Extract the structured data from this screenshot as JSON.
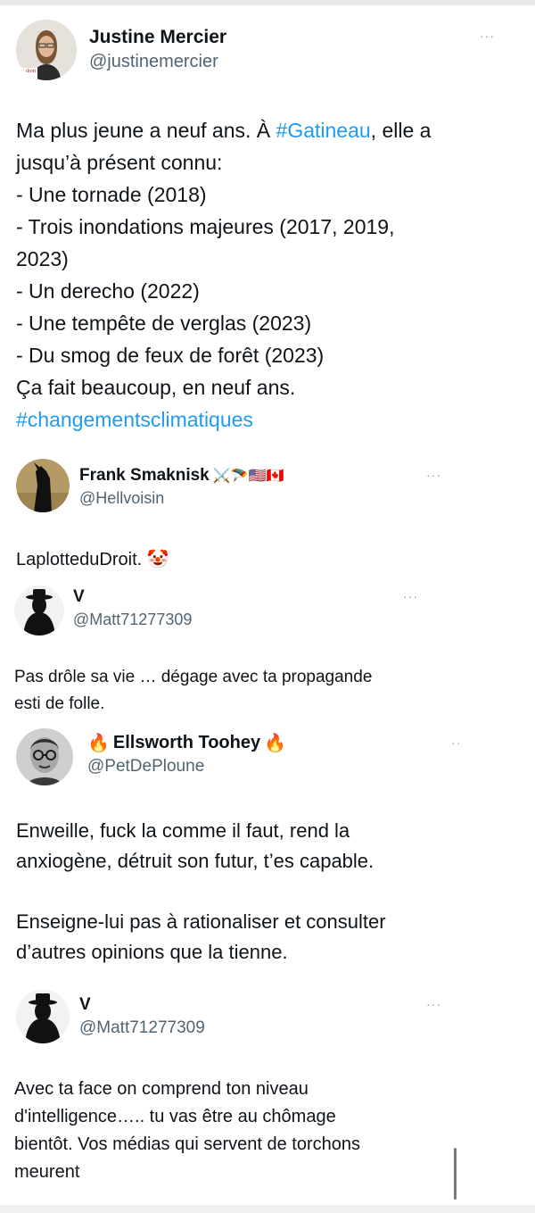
{
  "tweets": [
    {
      "name": "Justine Mercier",
      "handle": "@justinemercier",
      "avatar_badge": "le droit",
      "more": "···",
      "body_before": "Ma plus jeune a neuf ans. À ",
      "hashtag1": "#Gatineau",
      "body_middle": ", elle a\njusqu’à présent connu:\n- Une tornade (2018)\n- Trois inondations majeures (2017, 2019,\n2023)\n- Un derecho (2022)\n- Une tempête de verglas (2023)\n- Du smog de feux de forêt (2023)\nÇa fait beaucoup, en neuf ans.\n",
      "hashtag2": "#changementsclimatiques"
    },
    {
      "name": "Frank Smaknisk",
      "name_emoji": "⚔️🪂🇺🇸🇨🇦",
      "handle": "@Hellvoisin",
      "more": "···",
      "body": "LaplotteduDroit. 🤡"
    },
    {
      "name": "V",
      "handle": "@Matt71277309",
      "more": "···",
      "body": "Pas drôle sa vie … dégage avec ta propagande\nesti de folle."
    },
    {
      "name_prefix": "🔥",
      "name": "Ellsworth Toohey",
      "name_suffix": "🔥",
      "handle": "@PetDePloune",
      "more": "··",
      "body": "Enweille, fuck la comme il faut, rend la\nanxiogène, détruit son futur, t’es capable.\n\nEnseigne-lui pas à rationaliser et consulter\nd’autres opinions que la tienne."
    },
    {
      "name": "V",
      "handle": "@Matt71277309",
      "more": "···",
      "body": "Avec ta face on comprend ton niveau\nd'intelligence….. tu vas être au chômage\nbientôt. Vos médias qui servent de torchons\nmeurent"
    }
  ]
}
